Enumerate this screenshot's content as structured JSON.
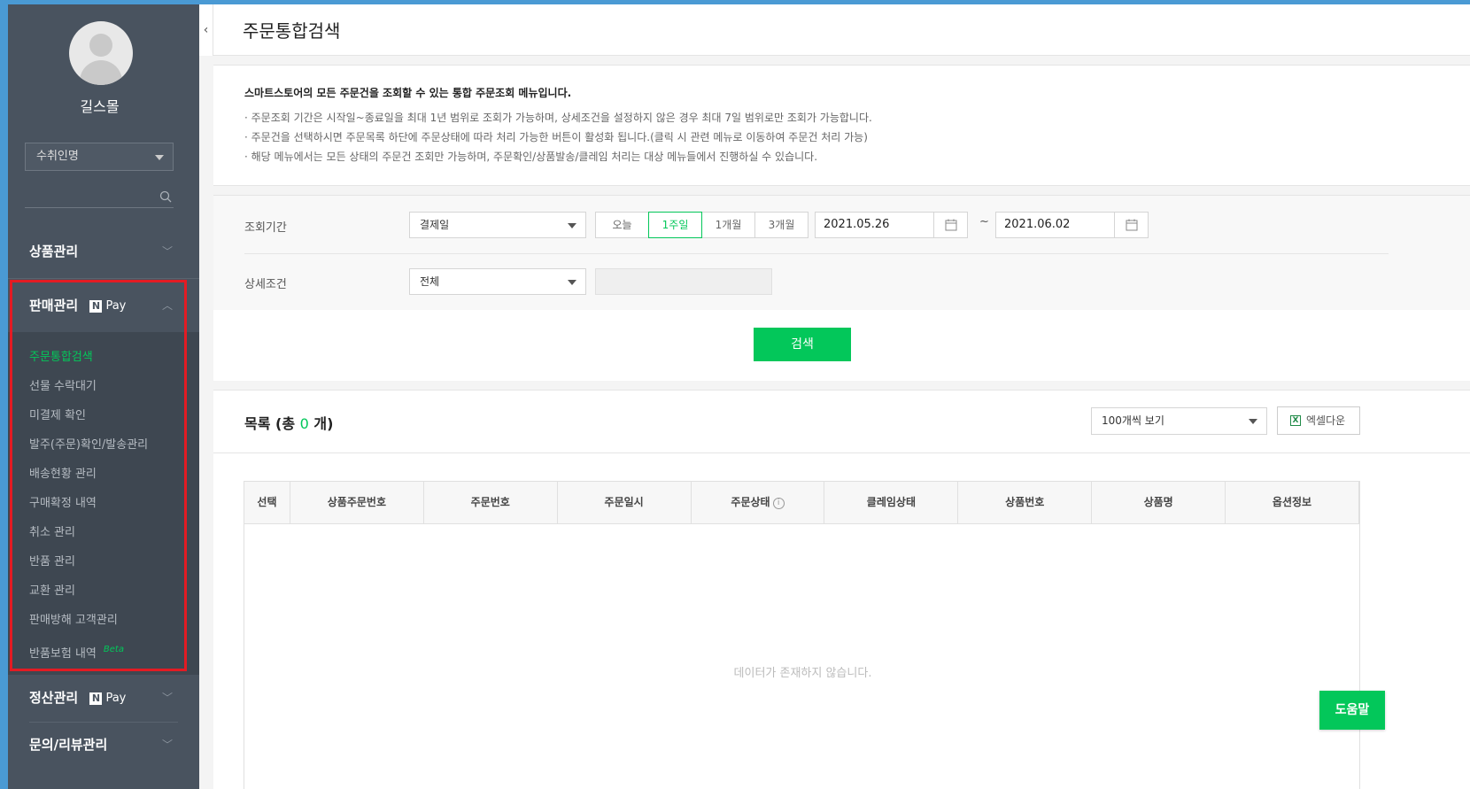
{
  "sidebar": {
    "store_name": "길스몰",
    "search_select": "수취인명",
    "menus": {
      "product": "상품관리",
      "sales": "판매관리",
      "settlement": "정산관리",
      "inquiry": "문의/리뷰관리"
    },
    "npay_label": "Pay",
    "npay_n": "N",
    "sales_items": [
      {
        "label": "주문통합검색"
      },
      {
        "label": "선물 수락대기"
      },
      {
        "label": "미결제 확인"
      },
      {
        "label": "발주(주문)확인/발송관리"
      },
      {
        "label": "배송현황 관리"
      },
      {
        "label": "구매확정 내역"
      },
      {
        "label": "취소 관리"
      },
      {
        "label": "반품 관리"
      },
      {
        "label": "교환 관리"
      },
      {
        "label": "판매방해 고객관리"
      },
      {
        "label": "반품보험 내역"
      }
    ],
    "beta": "Beta"
  },
  "page": {
    "title": "주문통합검색"
  },
  "info": {
    "title": "스마트스토어의 모든 주문건을 조회할 수 있는 통합 주문조회 메뉴입니다.",
    "lines": [
      "· 주문조회 기간은 시작일~종료일을 최대 1년 범위로 조회가 가능하며, 상세조건을 설정하지 않은 경우 최대 7일 범위로만 조회가 가능합니다.",
      "· 주문건을 선택하시면 주문목록 하단에 주문상태에 따라 처리 가능한 버튼이 활성화 됩니다.(클릭 시 관련 메뉴로 이동하여 주문건 처리 가능)",
      "· 해당 메뉴에서는 모든 상태의 주문건 조회만 가능하며, 주문확인/상품발송/클레임 처리는 대상 메뉴들에서 진행하실 수 있습니다."
    ]
  },
  "filter": {
    "period_label": "조회기간",
    "period_select": "결제일",
    "period_buttons": [
      "오늘",
      "1주일",
      "1개월",
      "3개월"
    ],
    "active_period": "1주일",
    "start_date": "2021.05.26",
    "tilde": "~",
    "end_date": "2021.06.02",
    "detail_label": "상세조건",
    "detail_select": "전체",
    "search_button": "검색"
  },
  "list": {
    "title_prefix": "목록 (총 ",
    "count": "0",
    "title_suffix": " 개)",
    "page_size_select": "100개씩 보기",
    "excel_button": "엑셀다운",
    "columns": [
      "선택",
      "상품주문번호",
      "주문번호",
      "주문일시",
      "주문상태",
      "클레임상태",
      "상품번호",
      "상품명",
      "옵션정보"
    ],
    "empty_message": "데이터가 존재하지 않습니다."
  },
  "help_button": "도움말",
  "colors": {
    "accent_green": "#03c75a",
    "sidebar_bg": "#49535f",
    "highlight_red": "#e31b23"
  }
}
